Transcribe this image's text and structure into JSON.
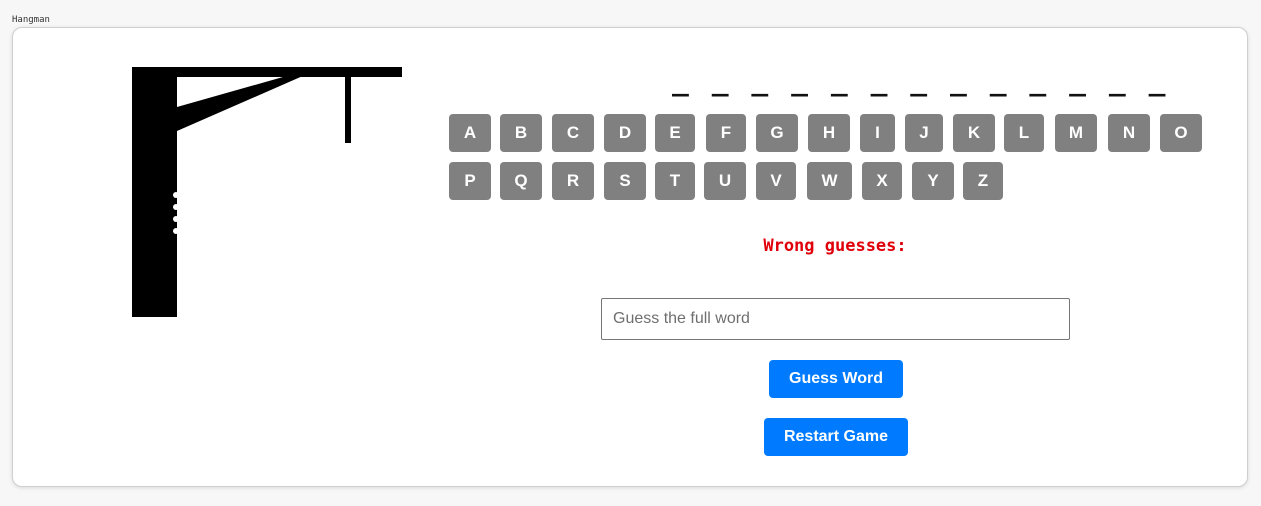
{
  "app": {
    "title": "Hangman"
  },
  "word": {
    "display": "_ _ _ _ _ _ _ _ _ _ _ _ _"
  },
  "keyboard": {
    "row1": [
      "A",
      "B",
      "C",
      "D",
      "E",
      "F",
      "G",
      "H",
      "I",
      "J",
      "K",
      "L",
      "M",
      "N",
      "O"
    ],
    "row2": [
      "P",
      "Q",
      "R",
      "S",
      "T",
      "U",
      "V",
      "W",
      "X",
      "Y",
      "Z"
    ]
  },
  "status": {
    "wrong_label": "Wrong guesses:",
    "wrong_letters": ""
  },
  "guess": {
    "placeholder": "Guess the full word",
    "value": ""
  },
  "actions": {
    "guess_label": "Guess Word",
    "restart_label": "Restart Game"
  },
  "colors": {
    "letter_bg": "#808080",
    "button_bg": "#007bff",
    "wrong_text": "#e0000a"
  }
}
